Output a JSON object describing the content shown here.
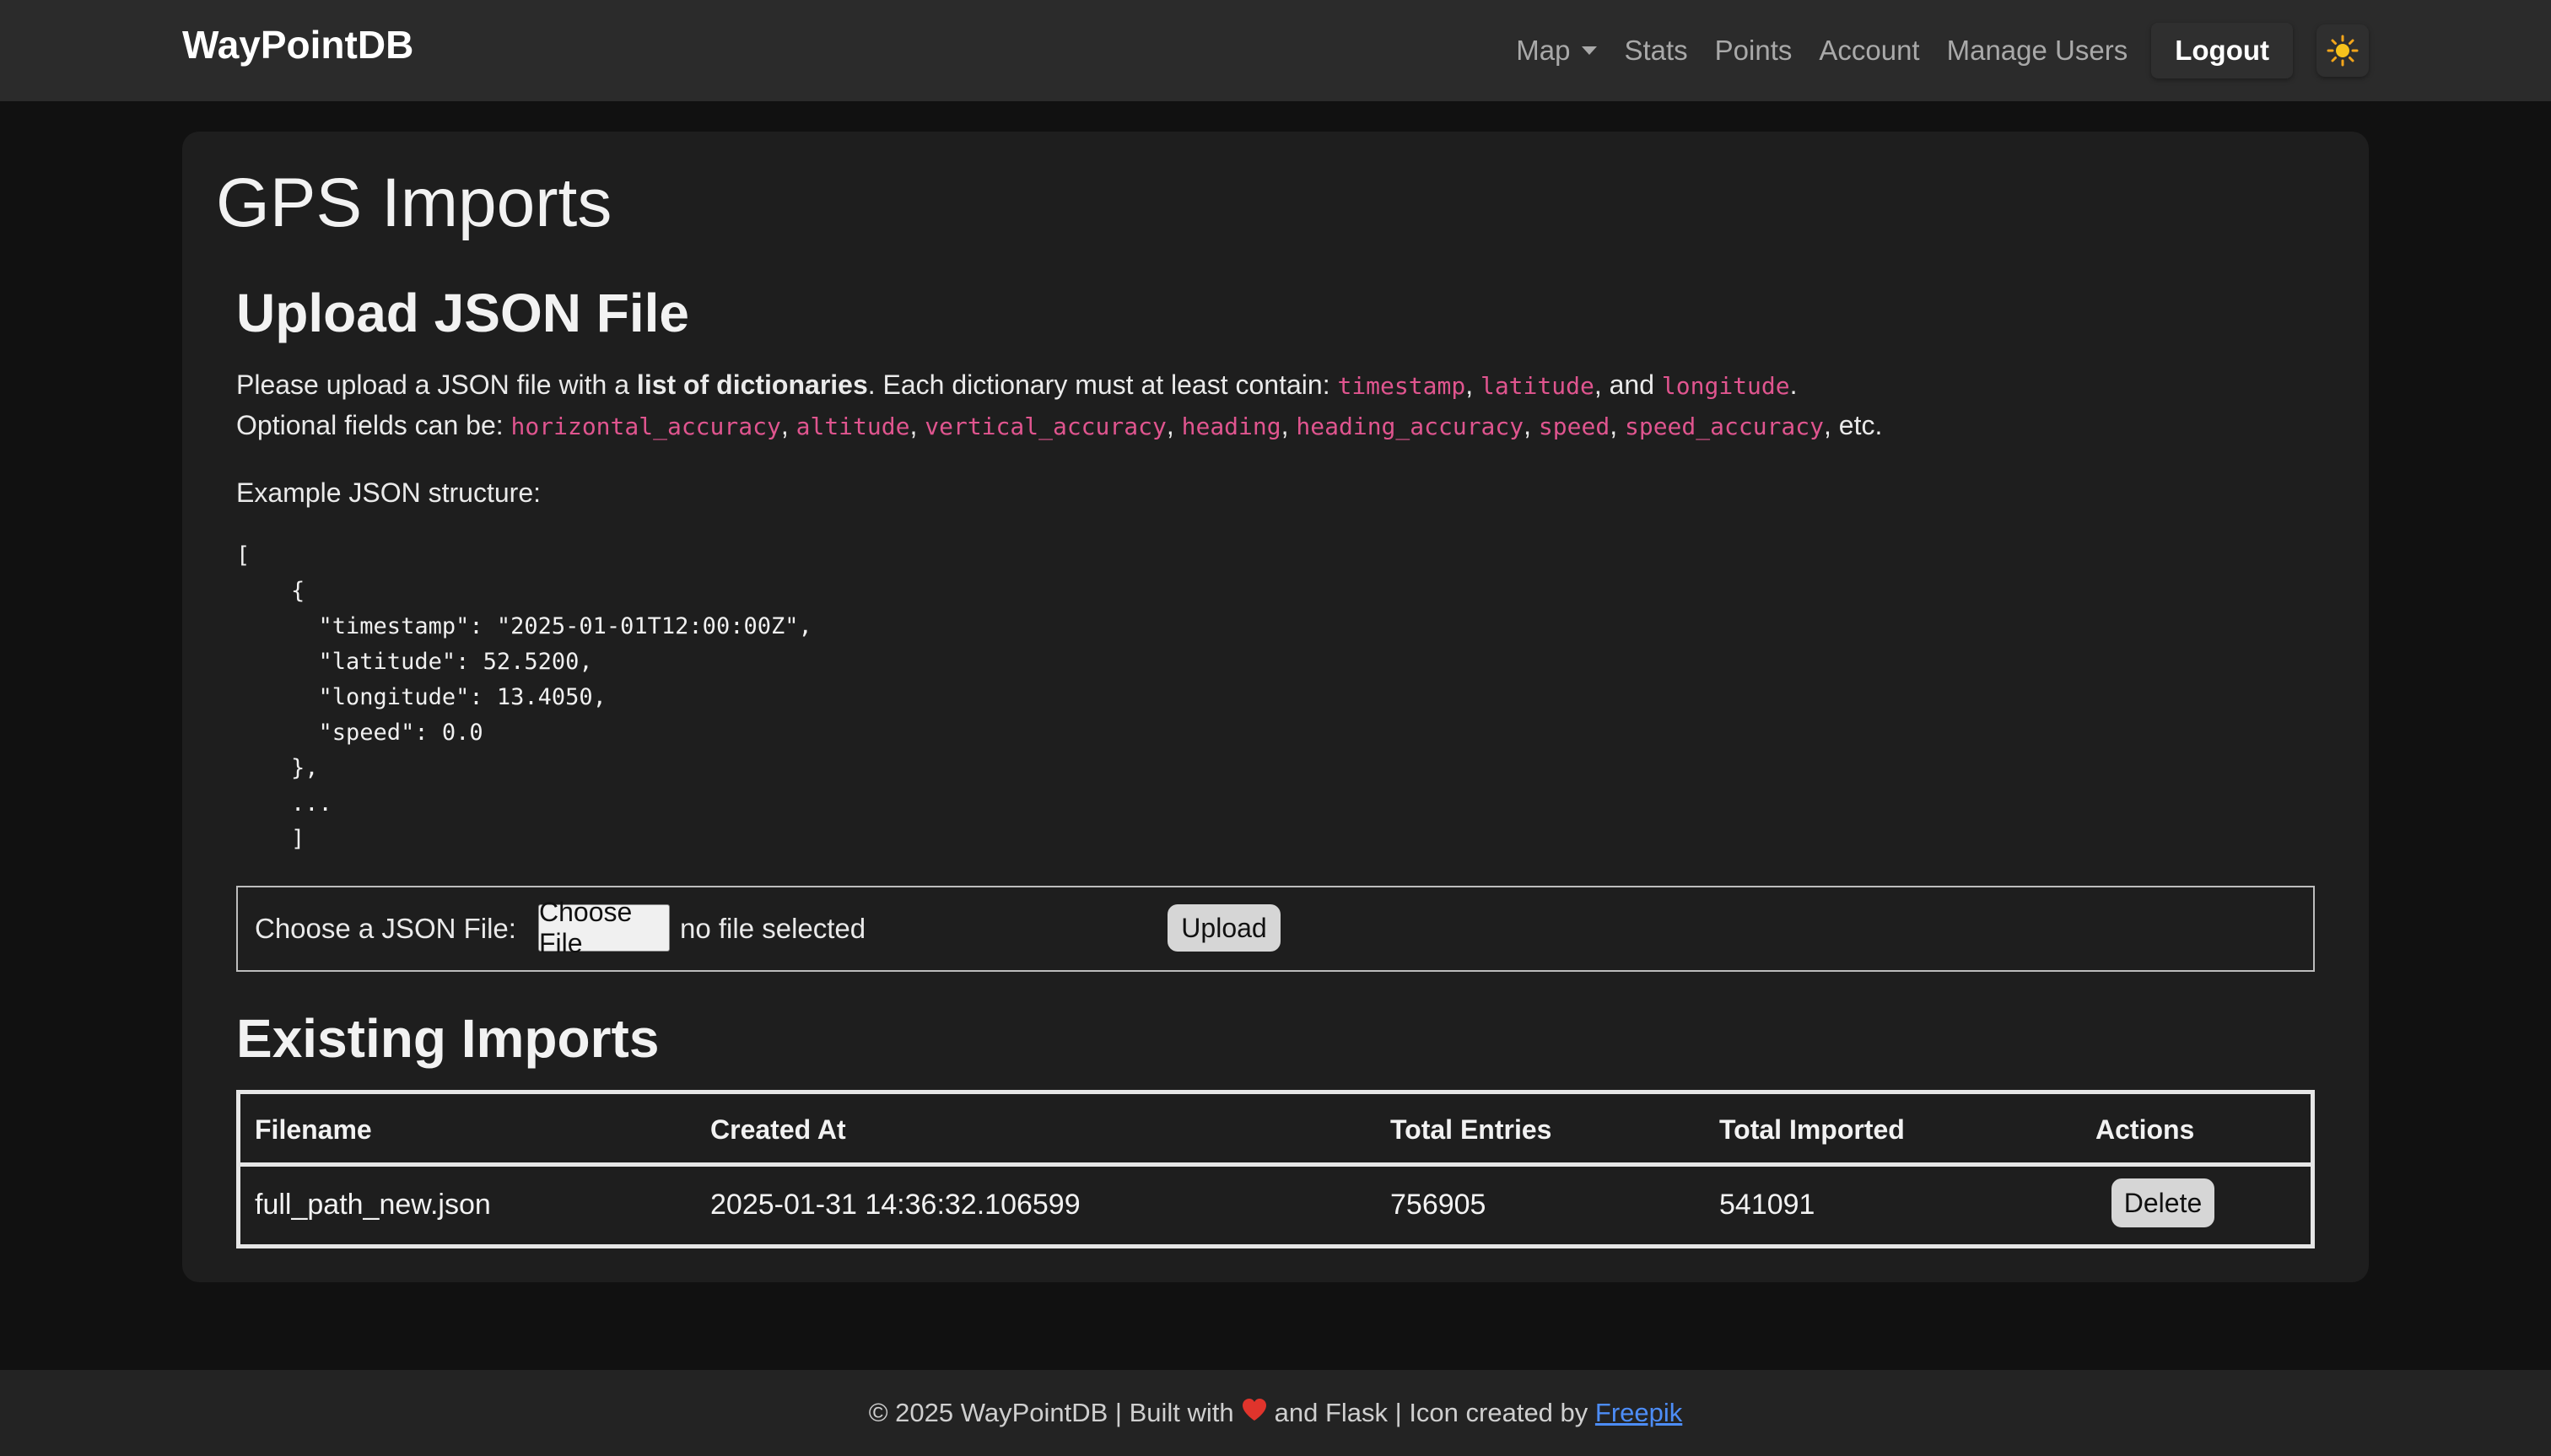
{
  "navbar": {
    "brand": "WayPointDB",
    "links": [
      "Map",
      "Stats",
      "Points",
      "Account",
      "Manage Users"
    ],
    "logout": "Logout",
    "theme_icon": "sun-icon"
  },
  "page": {
    "title": "GPS Imports"
  },
  "upload": {
    "title": "Upload JSON File",
    "line1_prefix": "Please upload a JSON file with a ",
    "line1_bold": "list of dictionaries",
    "line1_mid": ". Each dictionary must at least contain: ",
    "required_fields": [
      "timestamp",
      "latitude",
      "longitude"
    ],
    "line2_prefix": "Optional fields can be: ",
    "optional_fields": [
      "horizontal_accuracy",
      "altitude",
      "vertical_accuracy",
      "heading",
      "heading_accuracy",
      "speed",
      "speed_accuracy"
    ],
    "line2_suffix": ", etc.",
    "example_label": "Example JSON structure:",
    "example_code": "[\n    {\n      \"timestamp\": \"2025-01-01T12:00:00Z\",\n      \"latitude\": 52.5200,\n      \"longitude\": 13.4050,\n      \"speed\": 0.0\n    },\n    ...\n    ]",
    "file_label": "Choose a JSON File:",
    "choose_button": "Choose File",
    "file_status": "no file selected",
    "upload_button": "Upload"
  },
  "imports": {
    "title": "Existing Imports",
    "columns": [
      "Filename",
      "Created At",
      "Total Entries",
      "Total Imported",
      "Actions"
    ],
    "rows": [
      {
        "filename": "full_path_new.json",
        "created_at": "2025-01-31 14:36:32.106599",
        "total_entries": "756905",
        "total_imported": "541091",
        "action": "Delete"
      }
    ]
  },
  "footer": {
    "text_before": "© 2025 WayPointDB | Built with",
    "text_after": "and Flask | Icon created by",
    "link": "Freepik"
  }
}
